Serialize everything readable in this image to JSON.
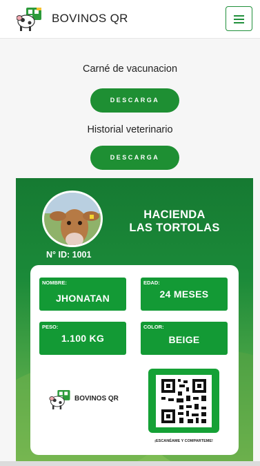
{
  "header": {
    "brand": "BOVINOS QR",
    "logo_icon": "cow-qr-logo-icon",
    "menu_icon": "hamburger-menu-icon"
  },
  "downloads": {
    "vaccination_title": "Carné de vacunacion",
    "vaccination_button": "DESCARGA",
    "history_title": "Historial veterinario",
    "history_button": "DESCARGA"
  },
  "card": {
    "ranch_line1": "HACIENDA",
    "ranch_line2": "LAS TORTOLAS",
    "id_label": "N° ID: 1001",
    "fields": {
      "name_label": "NOMBRE:",
      "name_value": "JHONATAN",
      "age_label": "EDAD:",
      "age_value": "24 MESES",
      "weight_label": "PESO:",
      "weight_value": "1.100 KG",
      "color_label": "COLOR:",
      "color_value": "BEIGE"
    },
    "footer_brand": "BOVINOS QR",
    "qr_caption": "¡ESCANÉAME Y COMPARTEME!"
  },
  "colors": {
    "accent_green": "#1e8f33",
    "field_green": "#139a35"
  }
}
